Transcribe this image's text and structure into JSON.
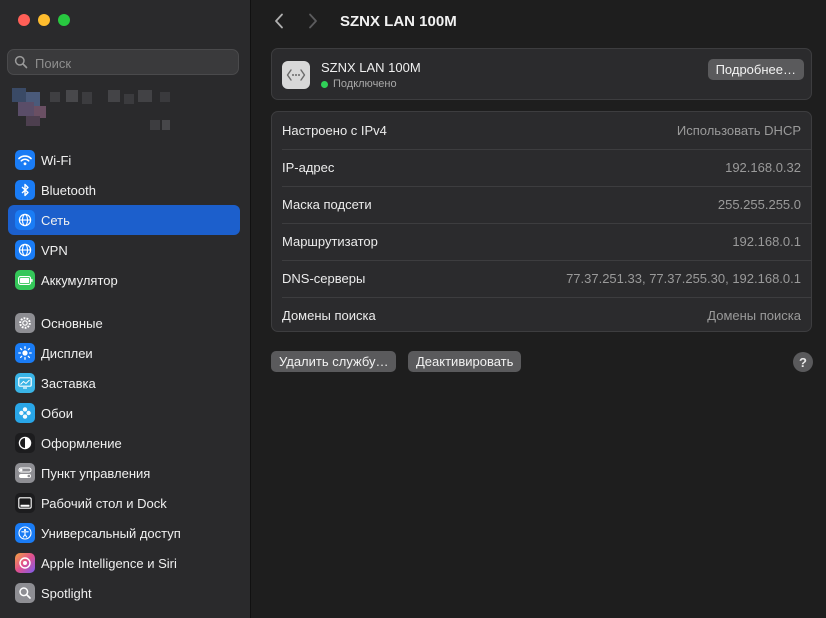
{
  "window": {
    "title": "SZNX LAN 100M"
  },
  "search": {
    "placeholder": "Поиск",
    "value": ""
  },
  "sidebar": {
    "items": [
      {
        "id": "wifi",
        "label": "Wi-Fi",
        "icon": "wifi-icon",
        "color": "#1a7cf5",
        "active": false
      },
      {
        "id": "bluetooth",
        "label": "Bluetooth",
        "icon": "bluetooth-icon",
        "color": "#1a7cf5",
        "active": false
      },
      {
        "id": "network",
        "label": "Сеть",
        "icon": "globe-icon",
        "color": "#1a7cf5",
        "active": true
      },
      {
        "id": "vpn",
        "label": "VPN",
        "icon": "globe-icon",
        "color": "#1a7cf5",
        "active": false
      },
      {
        "id": "battery",
        "label": "Аккумулятор",
        "icon": "battery-icon",
        "color": "#34c759",
        "active": false
      },
      {
        "id": "general",
        "label": "Основные",
        "icon": "gear-icon",
        "color": "#8e8e93",
        "active": false
      },
      {
        "id": "displays",
        "label": "Дисплеи",
        "icon": "sun-icon",
        "color": "#1a7cf5",
        "active": false
      },
      {
        "id": "screensaver",
        "label": "Заставка",
        "icon": "screensaver-icon",
        "color": "#3ab4e6",
        "active": false
      },
      {
        "id": "wallpaper",
        "label": "Обои",
        "icon": "flower-icon",
        "color": "#29a6e8",
        "active": false
      },
      {
        "id": "appearance",
        "label": "Оформление",
        "icon": "appearance-icon",
        "color": "#1c1c1e",
        "active": false
      },
      {
        "id": "control-center",
        "label": "Пункт управления",
        "icon": "toggles-icon",
        "color": "#8e8e93",
        "active": false
      },
      {
        "id": "desktop-dock",
        "label": "Рабочий стол и Dock",
        "icon": "dock-icon",
        "color": "#1c1c1e",
        "active": false
      },
      {
        "id": "accessibility",
        "label": "Универсальный доступ",
        "icon": "accessibility-icon",
        "color": "#1a7cf5",
        "active": false
      },
      {
        "id": "apple-intelligence",
        "label": "Apple Intelligence и Siri",
        "icon": "siri-icon",
        "color": "#e0508f",
        "active": false
      },
      {
        "id": "spotlight",
        "label": "Spotlight",
        "icon": "magnifier-icon",
        "color": "#8e8e93",
        "active": false
      }
    ]
  },
  "service": {
    "name": "SZNX LAN 100M",
    "status": "Подключено",
    "status_color": "#30d158",
    "details_label": "Подробнее…"
  },
  "info_rows": [
    {
      "label": "Настроено с IPv4",
      "value": "Использовать DHCP"
    },
    {
      "label": "IP-адрес",
      "value": "192.168.0.32"
    },
    {
      "label": "Маска подсети",
      "value": "255.255.255.0"
    },
    {
      "label": "Маршрутизатор",
      "value": "192.168.0.1"
    },
    {
      "label": "DNS-серверы",
      "value": "77.37.251.33, 77.37.255.30, 192.168.0.1"
    },
    {
      "label": "Домены поиска",
      "value": "Домены поиска"
    }
  ],
  "actions": {
    "remove_label": "Удалить службу…",
    "deactivate_label": "Деактивировать",
    "help_label": "?"
  },
  "colors": {
    "accent": "#1c5fcc",
    "window_bg": "#1e1e1e",
    "sidebar_bg": "#2a2a2c"
  }
}
